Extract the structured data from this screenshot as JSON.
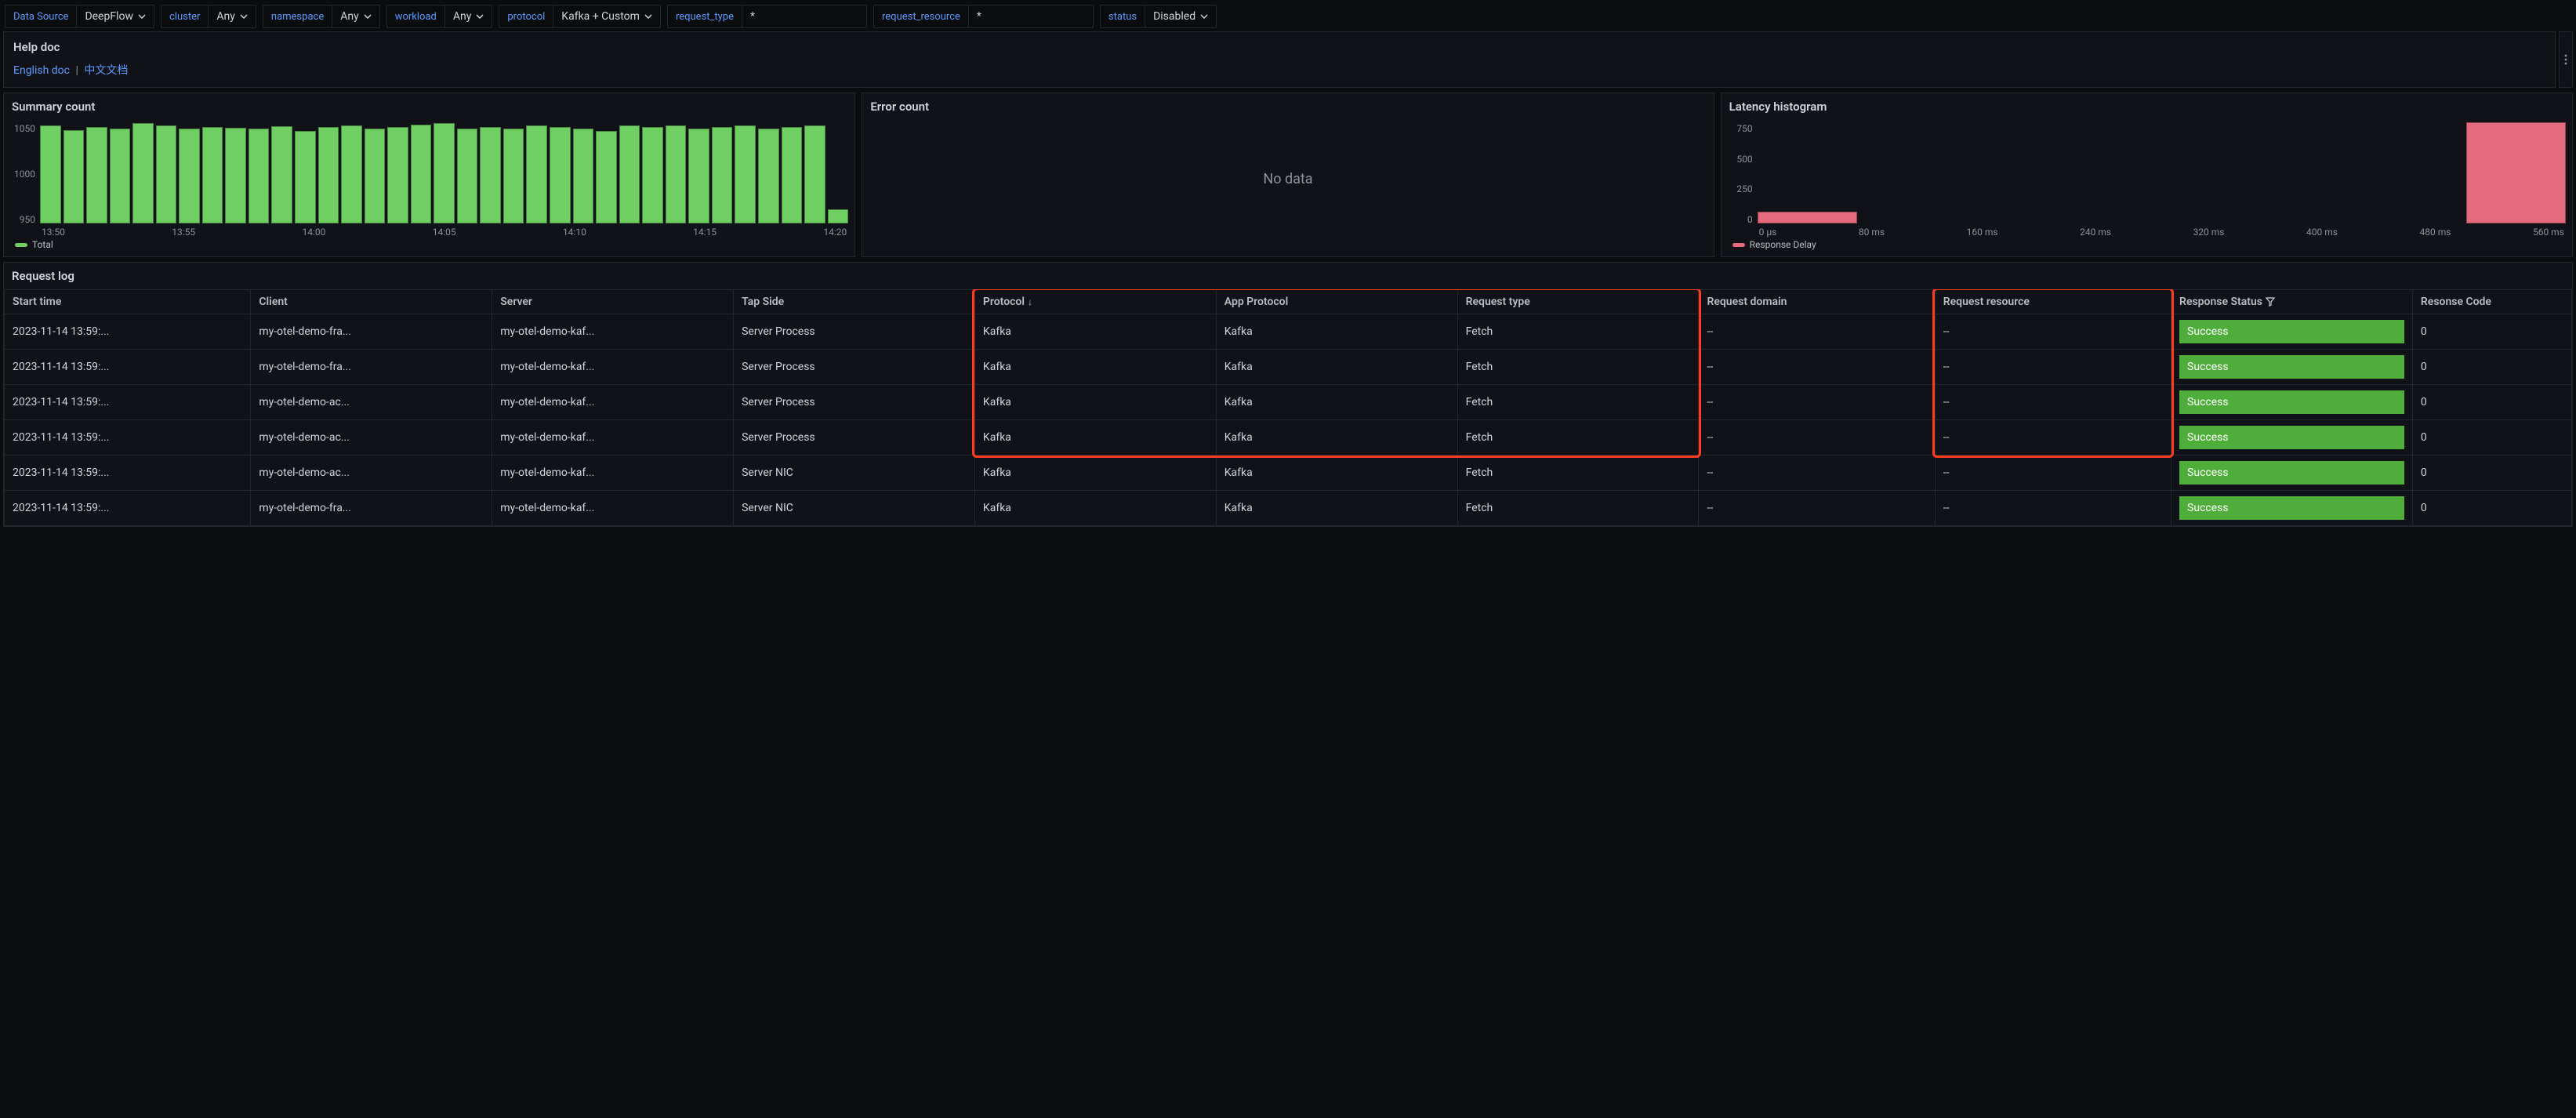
{
  "filters": [
    {
      "id": "data_source",
      "label": "Data Source",
      "value": "DeepFlow",
      "type": "select"
    },
    {
      "id": "cluster",
      "label": "cluster",
      "value": "Any",
      "type": "select"
    },
    {
      "id": "namespace",
      "label": "namespace",
      "value": "Any",
      "type": "select"
    },
    {
      "id": "workload",
      "label": "workload",
      "value": "Any",
      "type": "select"
    },
    {
      "id": "protocol",
      "label": "protocol",
      "value": "Kafka + Custom",
      "type": "select"
    },
    {
      "id": "request_type",
      "label": "request_type",
      "value": "*",
      "type": "text"
    },
    {
      "id": "request_resource",
      "label": "request_resource",
      "value": "*",
      "type": "text"
    },
    {
      "id": "status",
      "label": "status",
      "value": "Disabled",
      "type": "select"
    }
  ],
  "helpdoc": {
    "title": "Help doc",
    "links": {
      "english": "English doc",
      "chinese": "中文文档"
    }
  },
  "panels": {
    "summary": {
      "title": "Summary count",
      "legend_label": "Total"
    },
    "error": {
      "title": "Error count",
      "empty_text": "No data"
    },
    "latency": {
      "title": "Latency histogram",
      "legend_label": "Response Delay"
    }
  },
  "request_log": {
    "title": "Request log",
    "columns": [
      {
        "id": "start_time",
        "label": "Start time"
      },
      {
        "id": "client",
        "label": "Client"
      },
      {
        "id": "server",
        "label": "Server"
      },
      {
        "id": "tap_side",
        "label": "Tap Side"
      },
      {
        "id": "protocol",
        "label": "Protocol",
        "sort": "desc"
      },
      {
        "id": "app_protocol",
        "label": "App Protocol"
      },
      {
        "id": "request_type",
        "label": "Request type"
      },
      {
        "id": "request_domain",
        "label": "Request domain"
      },
      {
        "id": "request_resource",
        "label": "Request resource"
      },
      {
        "id": "response_status",
        "label": "Response Status",
        "filter": true
      },
      {
        "id": "response_code",
        "label": "Resonse Code"
      }
    ],
    "rows": [
      {
        "start_time": "2023-11-14 13:59:...",
        "client": "my-otel-demo-fra...",
        "server": "my-otel-demo-kaf...",
        "tap_side": "Server Process",
        "protocol": "Kafka",
        "app_protocol": "Kafka",
        "request_type": "Fetch",
        "request_domain": "--",
        "request_resource": "--",
        "response_status": "Success",
        "response_code": "0"
      },
      {
        "start_time": "2023-11-14 13:59:...",
        "client": "my-otel-demo-fra...",
        "server": "my-otel-demo-kaf...",
        "tap_side": "Server Process",
        "protocol": "Kafka",
        "app_protocol": "Kafka",
        "request_type": "Fetch",
        "request_domain": "--",
        "request_resource": "--",
        "response_status": "Success",
        "response_code": "0"
      },
      {
        "start_time": "2023-11-14 13:59:...",
        "client": "my-otel-demo-ac...",
        "server": "my-otel-demo-kaf...",
        "tap_side": "Server Process",
        "protocol": "Kafka",
        "app_protocol": "Kafka",
        "request_type": "Fetch",
        "request_domain": "--",
        "request_resource": "--",
        "response_status": "Success",
        "response_code": "0"
      },
      {
        "start_time": "2023-11-14 13:59:...",
        "client": "my-otel-demo-ac...",
        "server": "my-otel-demo-kaf...",
        "tap_side": "Server Process",
        "protocol": "Kafka",
        "app_protocol": "Kafka",
        "request_type": "Fetch",
        "request_domain": "--",
        "request_resource": "--",
        "response_status": "Success",
        "response_code": "0"
      },
      {
        "start_time": "2023-11-14 13:59:...",
        "client": "my-otel-demo-ac...",
        "server": "my-otel-demo-kaf...",
        "tap_side": "Server NIC",
        "protocol": "Kafka",
        "app_protocol": "Kafka",
        "request_type": "Fetch",
        "request_domain": "--",
        "request_resource": "--",
        "response_status": "Success",
        "response_code": "0"
      },
      {
        "start_time": "2023-11-14 13:59:...",
        "client": "my-otel-demo-fra...",
        "server": "my-otel-demo-kaf...",
        "tap_side": "Server NIC",
        "protocol": "Kafka",
        "app_protocol": "Kafka",
        "request_type": "Fetch",
        "request_domain": "--",
        "request_resource": "--",
        "response_status": "Success",
        "response_code": "0"
      }
    ]
  },
  "chart_data": [
    {
      "id": "summary_count",
      "type": "bar",
      "title": "Summary count",
      "xlabel": "",
      "ylabel": "",
      "yticks": [
        950,
        1000,
        1050
      ],
      "ylim": [
        920,
        1070
      ],
      "x_tick_labels": [
        "13:50",
        "13:55",
        "14:00",
        "14:05",
        "14:10",
        "14:15",
        "14:20"
      ],
      "legend": "Total",
      "n_bars": 35,
      "values": [
        1062,
        1055,
        1060,
        1058,
        1066,
        1062,
        1058,
        1060,
        1059,
        1058,
        1061,
        1054,
        1060,
        1062,
        1057,
        1060,
        1063,
        1065,
        1058,
        1060,
        1058,
        1062,
        1060,
        1058,
        1054,
        1062,
        1060,
        1062,
        1058,
        1060,
        1062,
        1058,
        1060,
        1062,
        940
      ]
    },
    {
      "id": "error_count",
      "type": "bar",
      "title": "Error count",
      "empty": true,
      "empty_text": "No data"
    },
    {
      "id": "latency_histogram",
      "type": "bar",
      "title": "Latency histogram",
      "xlabel": "",
      "ylabel": "",
      "yticks": [
        0,
        250,
        500,
        750
      ],
      "ylim": [
        0,
        800
      ],
      "x_tick_labels": [
        "0 µs",
        "80 ms",
        "160 ms",
        "240 ms",
        "320 ms",
        "400 ms",
        "480 ms",
        "560 ms"
      ],
      "legend": "Response Delay",
      "n_slots": 8,
      "values": [
        {
          "bin": 0,
          "count": 90
        },
        {
          "bin": 7,
          "count": 780
        }
      ]
    }
  ],
  "colors": {
    "accent_link": "#5a9bff",
    "bar_green": "#6fcf63",
    "bar_red": "#e56b7c",
    "status_success": "#4fae3a",
    "highlight_box": "#ff3b1f"
  }
}
